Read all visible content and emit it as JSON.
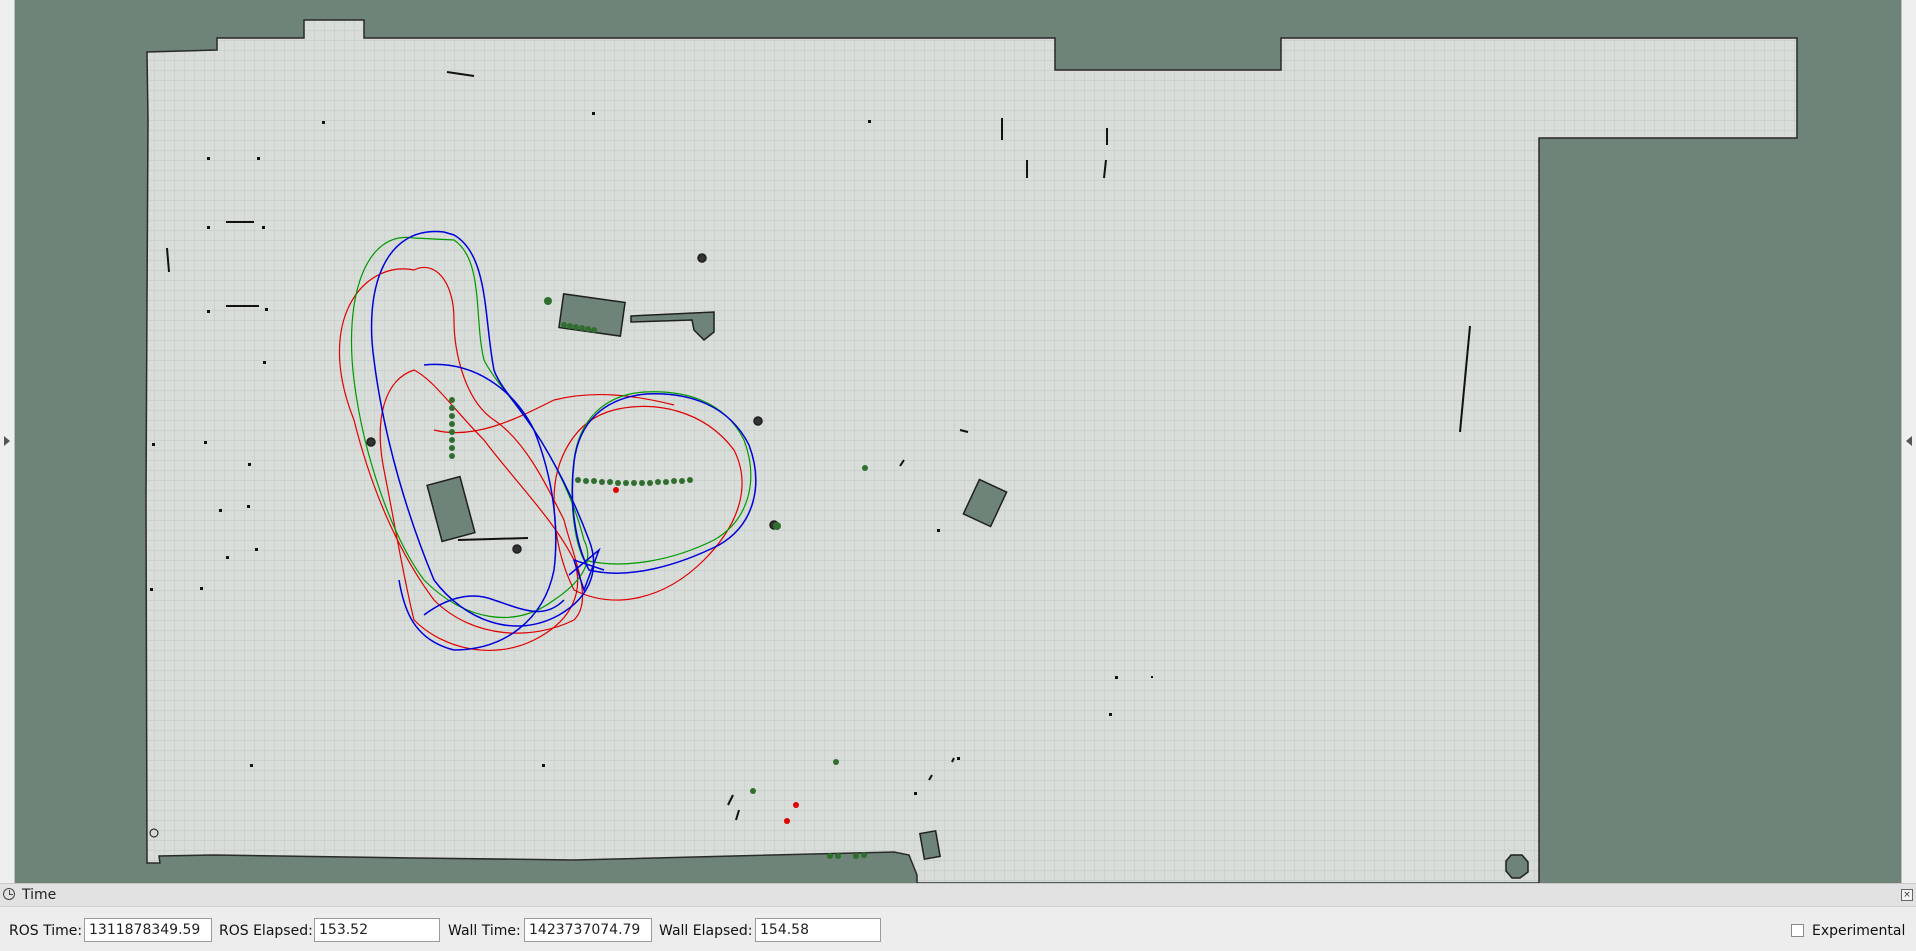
{
  "window": {
    "panel_title": "Time",
    "experimental_label": "Experimental",
    "experimental_checked": false
  },
  "time": {
    "ros_time_label": "ROS Time:",
    "ros_time_value": "1311878349.59",
    "ros_elapsed_label": "ROS Elapsed:",
    "ros_elapsed_value": "153.52",
    "wall_time_label": "Wall Time:",
    "wall_time_value": "1423737074.79",
    "wall_elapsed_label": "Wall Elapsed:",
    "wall_elapsed_value": "154.58"
  },
  "colors": {
    "unknown_space": "#6e8479",
    "free_space": "#d8ddd9",
    "grid_line": "#c3cbc5",
    "obstacle": "#1a1a1a",
    "path_red": "#e00000",
    "path_blue": "#0000dd",
    "path_green": "#00aa00",
    "landmark_green": "#2f6e2f"
  },
  "icons": {
    "panel_icon": "clock-icon",
    "close_icon": "close-icon",
    "left_collapse": "triangle-left-icon",
    "right_collapse": "triangle-right-icon"
  }
}
